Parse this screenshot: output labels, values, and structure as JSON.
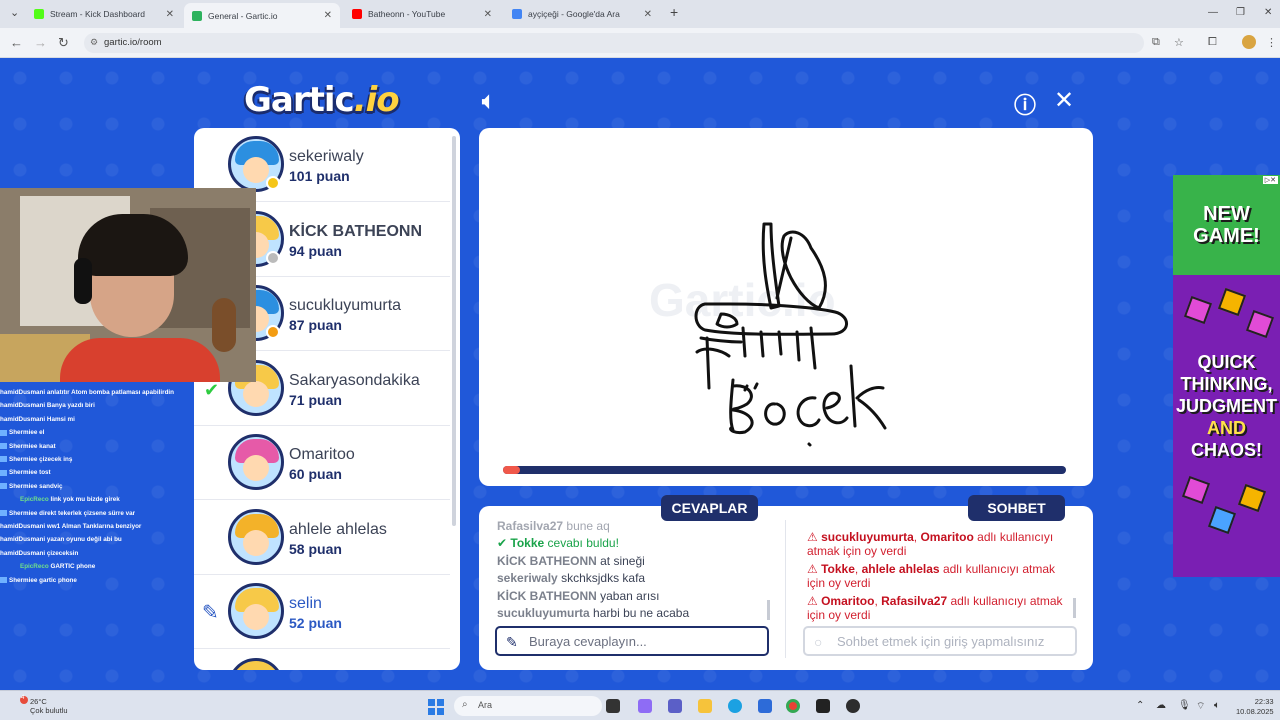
{
  "browser": {
    "tabs": [
      {
        "title": "Stream - Kick Dashboard",
        "color": "#53fc18",
        "active": false
      },
      {
        "title": "General - Gartic.io",
        "color": "#2db25e",
        "active": true
      },
      {
        "title": "Batheonn - YouTube",
        "color": "#ff0000",
        "active": false
      },
      {
        "title": "ayçiçeği - Google'da Ara",
        "color": "#4285f4",
        "active": false
      }
    ],
    "url": "gartic.io/room"
  },
  "game": {
    "logo_main": "Gartic",
    "logo_suffix": "io",
    "players": [
      {
        "name": "sekeriwaly",
        "score": "101 puan",
        "hair": "#2c8fe0",
        "dot": "#f5c518"
      },
      {
        "name": "KİCK BATHEONN",
        "score": "94 puan",
        "hair": "#f7c948",
        "dot": "#bbbbbb"
      },
      {
        "name": "sucukluyumurta",
        "score": "87 puan",
        "hair": "#2c8fe0",
        "dot": "#f39c12"
      },
      {
        "name": "Sakaryasondakika",
        "score": "71 puan",
        "hair": "#f7c948",
        "dot": ""
      },
      {
        "name": "Omaritoo",
        "score": "60 puan",
        "hair": "#e65aa8",
        "dot": ""
      },
      {
        "name": "ahlele ahlelas",
        "score": "58 puan",
        "hair": "#f3b229",
        "dot": ""
      },
      {
        "name": "selin",
        "score": "52 puan",
        "hair": "#f7c948",
        "dot": ""
      }
    ],
    "progress_fraction": 0.03,
    "answers_title": "CEVAPLAR",
    "chat_title": "SOHBET",
    "answers": [
      {
        "user": "Rafasilva27",
        "text": "bune aq",
        "type": "faded"
      },
      {
        "user": "Tokke",
        "text": "cevabı buldu!",
        "type": "correct"
      },
      {
        "user": "KİCK BATHEONN",
        "text": "at sineği",
        "type": "normal"
      },
      {
        "user": "sekeriwaly",
        "text": "skchksjdks kafa",
        "type": "normal"
      },
      {
        "user": "KİCK BATHEONN",
        "text": "yaban arısı",
        "type": "normal"
      },
      {
        "user": "sucukluyumurta",
        "text": "harbi bu ne acaba",
        "type": "normal"
      }
    ],
    "chat": [
      {
        "a": "sucukluyumurta",
        "b": "Omaritoo",
        "text": "adlı kullanıcıyı atmak için oy verdi"
      },
      {
        "a": "Tokke",
        "b": "ahlele ahlelas",
        "text": "adlı kullanıcıyı atmak için oy verdi"
      },
      {
        "a": "Omaritoo",
        "b": "Rafasilva27",
        "text": "adlı kullanıcıyı atmak için oy verdi"
      }
    ],
    "answer_placeholder": "Buraya cevaplayın...",
    "chat_placeholder": "Sohbet etmek için giriş yapmalısınız"
  },
  "stream_chat": [
    {
      "user": "hamidDusmani",
      "msg": "anlatıtır Atom bomba patlaması apabilirdin",
      "icon": false
    },
    {
      "user": "hamidDusmani",
      "msg": "Banya yazdı biri",
      "icon": false
    },
    {
      "user": "hamidDusmani",
      "msg": "Hamsi mi",
      "icon": false
    },
    {
      "user": "Shermiee",
      "msg": "el",
      "icon": true
    },
    {
      "user": "Shermiee",
      "msg": "kanat",
      "icon": true
    },
    {
      "user": "Shermiee",
      "msg": "çizecek inş",
      "icon": true
    },
    {
      "user": "Shermiee",
      "msg": "tost",
      "icon": true
    },
    {
      "user": "Shermiee",
      "msg": "sandviç",
      "icon": true
    },
    {
      "user": "EpicReco",
      "msg": "link yok mu bizde girek",
      "icon": false
    },
    {
      "user": "Shermiee",
      "msg": "direkt tekerlek çizsene sürre var",
      "icon": true
    },
    {
      "user": "hamidDusmani",
      "msg": "ww1 Alman Tanklarına benziyor",
      "icon": false
    },
    {
      "user": "hamidDusmani",
      "msg": "yazan oyunu değil abi bu",
      "icon": false
    },
    {
      "user": "hamidDusmani",
      "msg": "çizeceksin",
      "icon": false
    },
    {
      "user": "EpicReco",
      "msg": "GARTIC phone",
      "icon": false
    },
    {
      "user": "Shermiee",
      "msg": "gartic phone",
      "icon": true
    }
  ],
  "ad": {
    "headline": "NEW GAME!",
    "body_1": "QUICK THINKING,",
    "body_2": "JUDGMENT",
    "body_and": "AND",
    "body_3": "CHAOS!"
  },
  "taskbar": {
    "temp": "26°C",
    "weather": "Çok bulutlu",
    "search": "Ara",
    "time": "22:33",
    "date": "10.08.2025",
    "weather_badge": "4"
  }
}
